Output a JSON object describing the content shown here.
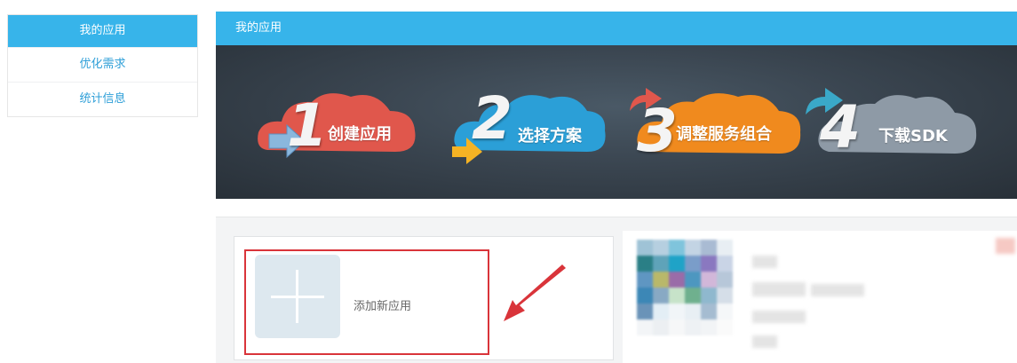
{
  "sidebar": {
    "items": [
      {
        "label": "我的应用",
        "active": true
      },
      {
        "label": "优化需求",
        "active": false
      },
      {
        "label": "统计信息",
        "active": false
      }
    ]
  },
  "main": {
    "title": "我的应用",
    "steps": [
      {
        "number": "1",
        "label": "创建应用",
        "color": "#e0574c"
      },
      {
        "number": "2",
        "label": "选择方案",
        "color": "#2b9fd7"
      },
      {
        "number": "3",
        "label": "调整服务组合",
        "color": "#f08a1e"
      },
      {
        "number": "4",
        "label": "下载SDK",
        "color": "#8e9aa6"
      }
    ],
    "add_app_label": "添加新应用"
  },
  "colors": {
    "accent": "#37b4ea",
    "highlight": "#d9343a"
  }
}
